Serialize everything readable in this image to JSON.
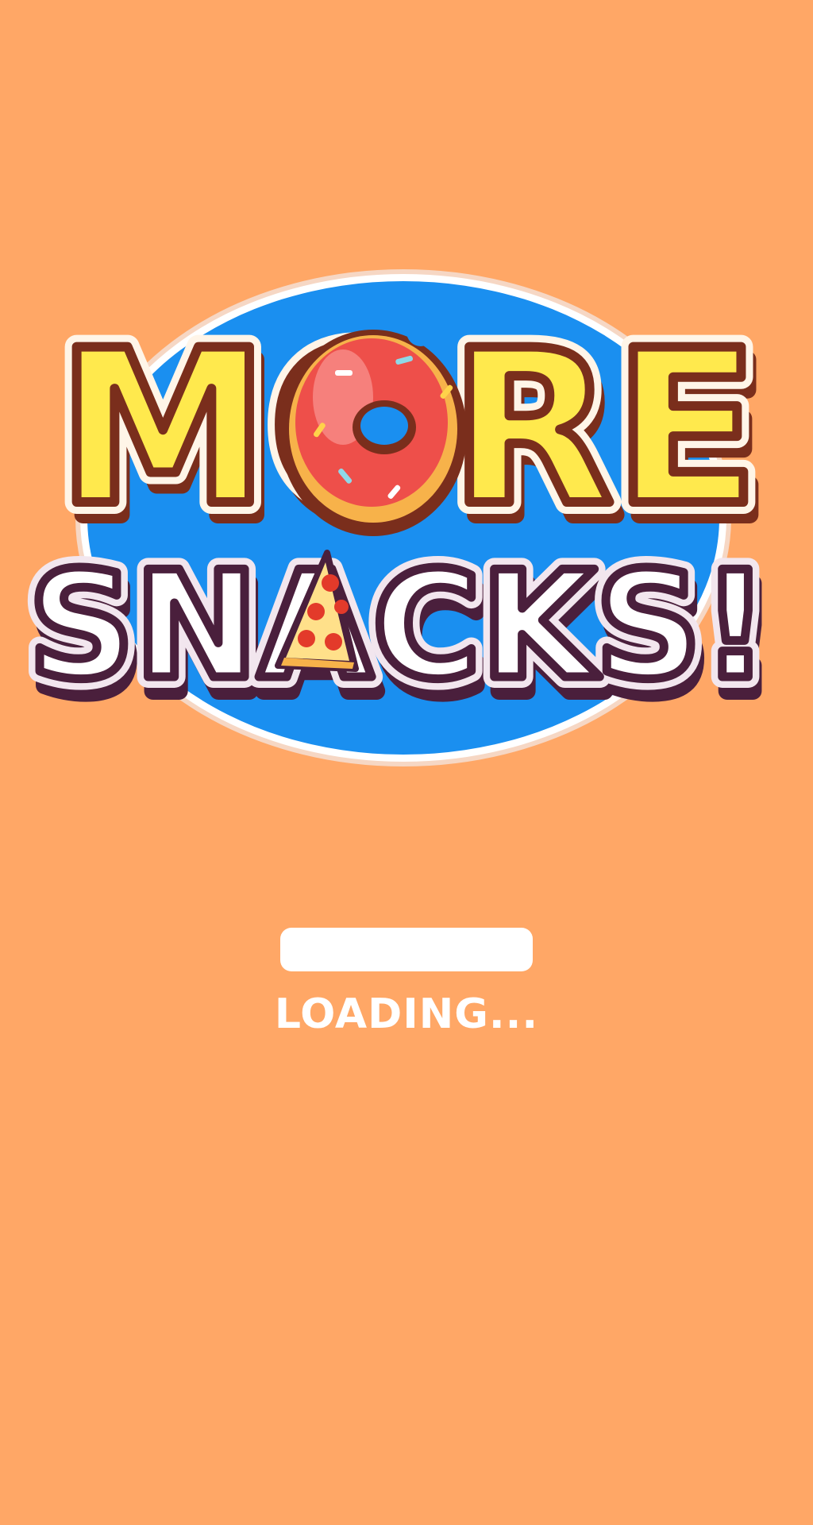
{
  "logo": {
    "line1": "MORE",
    "line2": "SNACKS!"
  },
  "loading": {
    "label": "LOADING...",
    "progress_fraction": 0
  },
  "colors": {
    "background": "#FFA766",
    "badge_blue": "#1A8FF0",
    "title_yellow": "#FFE94D",
    "title_outline_brown": "#7A2E1C",
    "subtitle_white": "#FFFFFF",
    "subtitle_outline_purple": "#4A1F3C",
    "donut_red": "#EE4F4A",
    "pizza_crust": "#F7B24A",
    "pepperoni": "#E33A2A"
  },
  "icons": [
    "donut-icon",
    "pizza-slice-icon"
  ]
}
